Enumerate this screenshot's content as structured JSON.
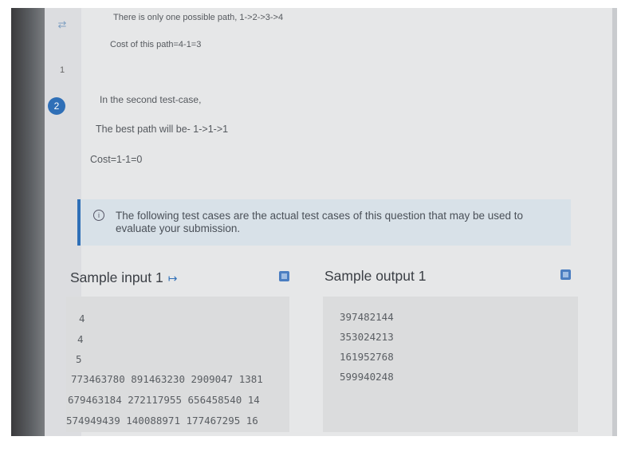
{
  "sidebar": {
    "top_icon": "⇄",
    "prev_question": "1",
    "current_question": "2"
  },
  "explanation": {
    "line1": "There is only one possible path, 1->2->3->4",
    "line2": "Cost of this path=4-1=3",
    "line3": "In the second test-case,",
    "line4": "The best path will be- 1->1->1",
    "line5": "Cost=1-1=0"
  },
  "notice": {
    "icon": "info-icon",
    "text": "The following test cases are the actual test cases of this question that may be used to evaluate your submission."
  },
  "sample_input": {
    "title": "Sample input 1",
    "arrow": "↦",
    "lines": [
      "4",
      "4",
      "5",
      "773463780 891463230 2909047 1381",
      "679463184 272117955 656458540 14",
      "574949439 140088971 177467295 16"
    ]
  },
  "sample_output": {
    "title": "Sample output 1",
    "lines": [
      "397482144",
      "353024213",
      "161952768",
      "599940248"
    ]
  },
  "colors": {
    "accent": "#2f6fb7",
    "notice_bg": "#d8e1e8",
    "code_bg": "#dbdcdd"
  }
}
